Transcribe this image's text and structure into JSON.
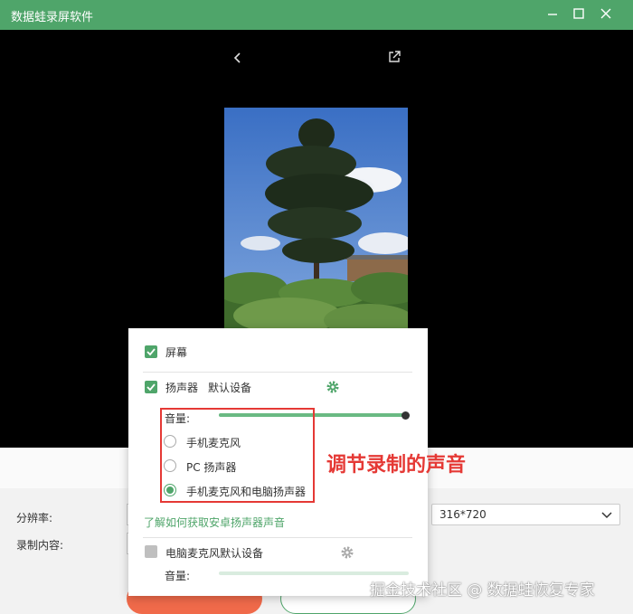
{
  "app": {
    "title": "数据蛙录屏软件"
  },
  "window_controls": [
    "minimize-icon",
    "maximize-icon",
    "close-icon"
  ],
  "viewer": {
    "back_icon": "chevron-left-icon",
    "open_external_icon": "open-external-icon",
    "photo_description_icon": "tree-photo"
  },
  "settings": {
    "resolution_label": "分辨率:",
    "resolution_value": "316*720",
    "content_label": "录制内容:"
  },
  "audio_panel": {
    "screen_label": "屏幕",
    "speaker_label": "扬声器",
    "speaker_device": "默认设备",
    "volume_label": "音量:",
    "speaker_volume": 1.0,
    "options": [
      {
        "label": "手机麦克风",
        "selected": false
      },
      {
        "label": "PC 扬声器",
        "selected": false
      },
      {
        "label": "手机麦克风和电脑扬声器",
        "selected": true
      }
    ],
    "help_link": "了解如何获取安卓扬声器声音",
    "mic_label": "电脑麦克风默认设备",
    "mic_volume_label": "音量:",
    "mic_enabled": false
  },
  "annotation": {
    "text": "调节录制的声音"
  },
  "watermark": {
    "text": "掘金技术社区 @ 数据蛙恢复专家"
  },
  "colors": {
    "accent": "#4fa56a",
    "annotation": "#e53935",
    "record_button": "#f06a4a"
  }
}
